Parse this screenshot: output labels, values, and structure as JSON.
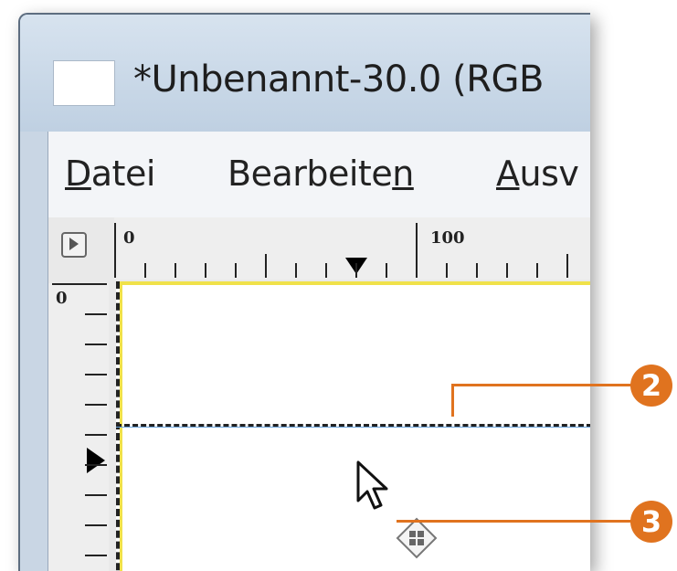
{
  "window": {
    "title": "*Unbenannt-30.0 (RGB"
  },
  "menu": [
    {
      "pre": "",
      "key": "D",
      "post": "atei"
    },
    {
      "pre": "Bearbeite",
      "key": "n",
      "post": ""
    },
    {
      "pre": "",
      "key": "A",
      "post": "usv"
    }
  ],
  "rulers": {
    "horizontal_labels": [
      "0",
      "100"
    ],
    "vertical_labels": [
      "0"
    ]
  },
  "callouts": {
    "guide": "2",
    "move_cursor": "3"
  },
  "colors": {
    "callout": "#e0731f",
    "selection_yellow": "#f0e14a",
    "guide_blue": "#6aa4dc"
  },
  "icons": {
    "ruler_toggle": "play-triangle-icon",
    "cursor": "arrow-cursor-icon",
    "move": "move-cursor-icon"
  }
}
